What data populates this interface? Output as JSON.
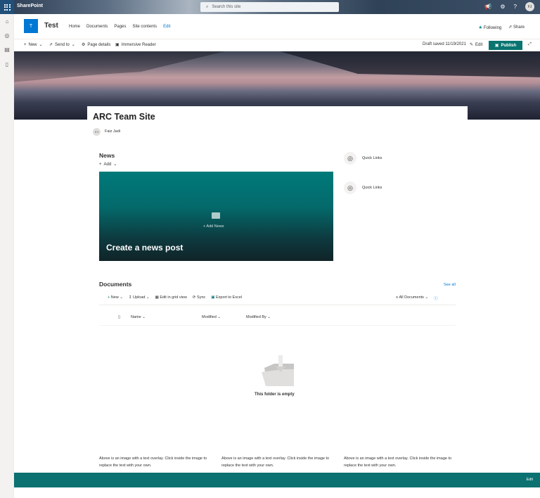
{
  "suite": {
    "brand": "SharePoint",
    "search_placeholder": "Search this site",
    "avatar": "FJ"
  },
  "site": {
    "logo_letter": "T",
    "title": "Test",
    "nav": [
      "Home",
      "Documents",
      "Pages",
      "Site contents",
      "Edit"
    ],
    "following": "Following",
    "share": "Share"
  },
  "cmdbar": {
    "new": "New",
    "send_to": "Send to",
    "page_details": "Page details",
    "immersive_reader": "Immersive Reader",
    "draft_saved": "Draft saved 11/19/2021",
    "edit": "Edit",
    "publish": "Publish"
  },
  "page": {
    "title": "ARC Team Site",
    "author": "Faiz Jadi",
    "author_initials": "FJ"
  },
  "news": {
    "heading": "News",
    "add": "Add",
    "add_news": "+ Add News",
    "cta": "Create a news post"
  },
  "quick_links": [
    "Quick Links",
    "Quick Links"
  ],
  "documents": {
    "heading": "Documents",
    "see_all": "See all",
    "commands": [
      "New",
      "Upload",
      "Edit in grid view",
      "Sync",
      "Export to Excel"
    ],
    "view": "All Documents",
    "columns": [
      "Name",
      "Modified",
      "Modified By"
    ],
    "empty": "This folder is empty"
  },
  "captions": [
    "Above is an image with a text overlay. Click inside the image to replace the text with your own.",
    "Above is an image with a text overlay. Click inside the image to replace the text with your own.",
    "Above is an image with a text overlay. Click inside the image to replace the text with your own."
  ],
  "footer": {
    "edit": "Edit"
  },
  "colors": {
    "accent": "#0a7570",
    "link": "#0078d4",
    "suite_blue": "#20507a"
  }
}
